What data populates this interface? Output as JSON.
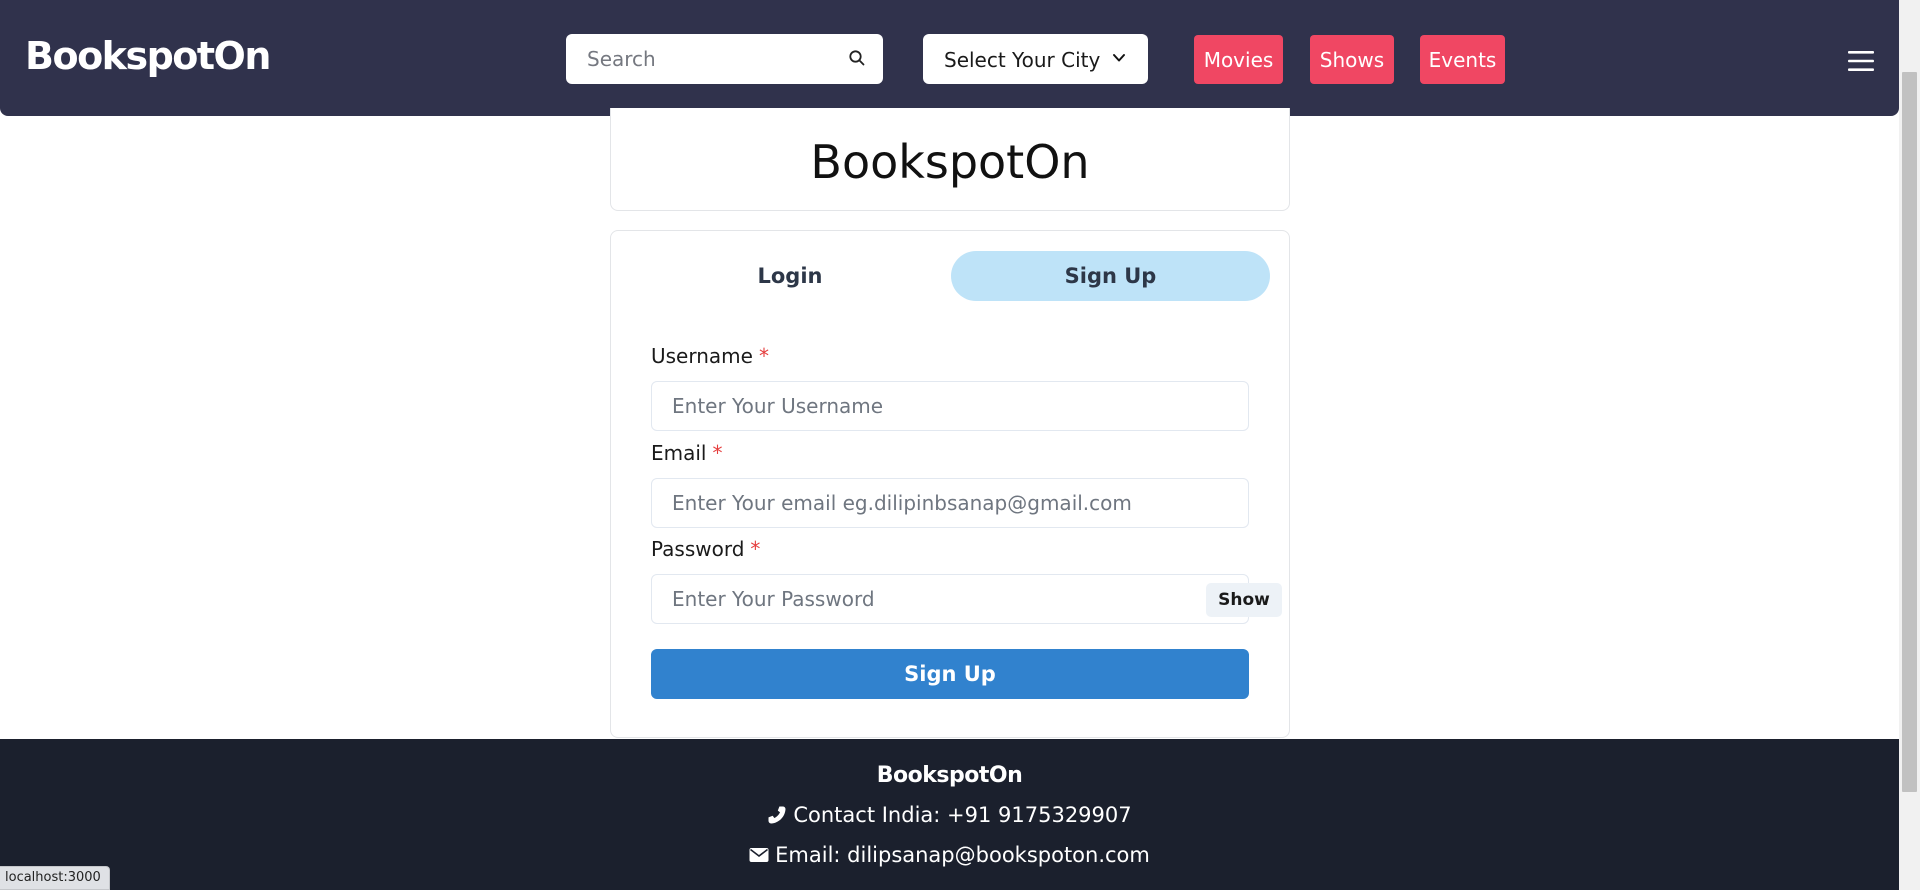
{
  "navbar": {
    "brand": "BookspotOn",
    "search_placeholder": "Search",
    "city_select": "Select Your City",
    "links": {
      "movies": "Movies",
      "shows": "Shows",
      "events": "Events"
    },
    "icons": {
      "search": "search-icon",
      "chevron": "chevron-down-icon",
      "menu": "hamburger-menu-icon"
    },
    "colors": {
      "background": "#30324c",
      "link_bg": "#f04763"
    }
  },
  "title_card": {
    "title": "BookspotOn"
  },
  "auth": {
    "tabs": {
      "login": "Login",
      "signup": "Sign Up"
    },
    "active_tab": "Sign Up",
    "fields": {
      "username": {
        "label": "Username",
        "required_mark": "*",
        "placeholder": "Enter Your Username",
        "value": ""
      },
      "email": {
        "label": "Email",
        "required_mark": "*",
        "placeholder": "Enter Your email eg.dilipinbsanap@gmail.com",
        "value": ""
      },
      "password": {
        "label": "Password",
        "required_mark": "*",
        "placeholder": "Enter Your Password",
        "value": "",
        "toggle_label": "Show"
      }
    },
    "submit_label": "Sign Up",
    "colors": {
      "active_tab": "#bee3f8",
      "submit": "#3182ce",
      "required": "#e53e3e"
    }
  },
  "footer": {
    "brand": "BookspotOn",
    "contact": "Contact India: +91 9175329907",
    "email": "Email: dilipsanap@bookspoton.com",
    "icons": {
      "phone": "phone-icon",
      "email": "envelope-icon"
    },
    "colors": {
      "background": "#1b202d"
    }
  },
  "status_bar": {
    "url": "localhost:3000"
  }
}
